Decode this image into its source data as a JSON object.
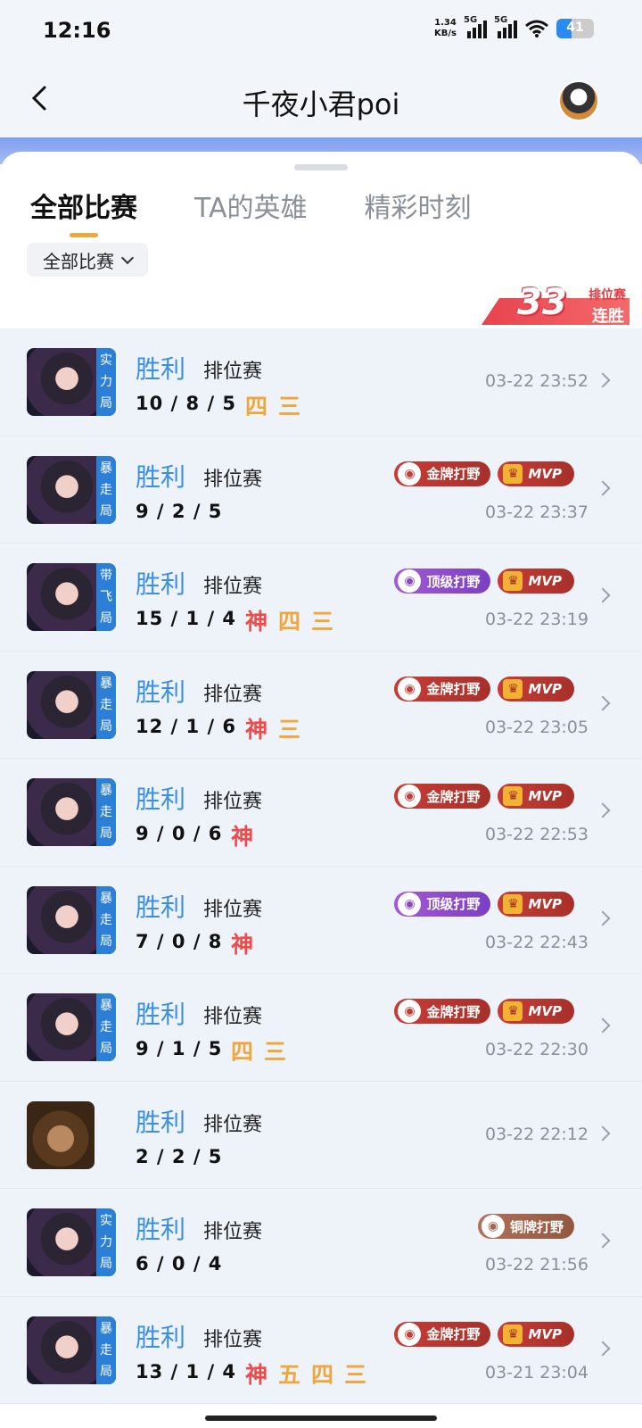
{
  "status": {
    "time": "12:16",
    "net_speed_value": "1.34",
    "net_speed_unit": "KB/s",
    "sig1": "5G",
    "sig2": "5G",
    "battery": "41"
  },
  "header": {
    "title": "千夜小君poi"
  },
  "tabs": [
    "全部比赛",
    "TA的英雄",
    "精彩时刻"
  ],
  "filter": {
    "label": "全部比赛"
  },
  "streak": {
    "count": "33",
    "top": "排位赛",
    "bottom": "连胜"
  },
  "matches": [
    {
      "tag": "实力局",
      "hero": "girl",
      "result": "胜利",
      "mode": "排位赛",
      "kda": "10 / 8 / 5",
      "marks": [
        "四",
        "三"
      ],
      "badges": [],
      "time": "03-22 23:52"
    },
    {
      "tag": "暴走局",
      "hero": "girl",
      "result": "胜利",
      "mode": "排位赛",
      "kda": "9 / 2 / 5",
      "marks": [],
      "badges": [
        "金牌打野",
        "MVP"
      ],
      "time": "03-22 23:37"
    },
    {
      "tag": "带飞局",
      "hero": "girl",
      "result": "胜利",
      "mode": "排位赛",
      "kda": "15 / 1 / 4",
      "marks": [
        "神",
        "四",
        "三"
      ],
      "badges": [
        "顶级打野",
        "MVP"
      ],
      "time": "03-22 23:19"
    },
    {
      "tag": "暴走局",
      "hero": "girl",
      "result": "胜利",
      "mode": "排位赛",
      "kda": "12 / 1 / 6",
      "marks": [
        "神",
        "三"
      ],
      "badges": [
        "金牌打野",
        "MVP"
      ],
      "time": "03-22 23:05"
    },
    {
      "tag": "暴走局",
      "hero": "girl",
      "result": "胜利",
      "mode": "排位赛",
      "kda": "9 / 0 / 6",
      "marks": [
        "神"
      ],
      "badges": [
        "金牌打野",
        "MVP"
      ],
      "time": "03-22 22:53"
    },
    {
      "tag": "暴走局",
      "hero": "girl",
      "result": "胜利",
      "mode": "排位赛",
      "kda": "7 / 0 / 8",
      "marks": [
        "神"
      ],
      "badges": [
        "顶级打野",
        "MVP"
      ],
      "time": "03-22 22:43"
    },
    {
      "tag": "暴走局",
      "hero": "girl",
      "result": "胜利",
      "mode": "排位赛",
      "kda": "9 / 1 / 5",
      "marks": [
        "四",
        "三"
      ],
      "badges": [
        "金牌打野",
        "MVP"
      ],
      "time": "03-22 22:30"
    },
    {
      "tag": "",
      "hero": "monk",
      "result": "胜利",
      "mode": "排位赛",
      "kda": "2 / 2 / 5",
      "marks": [],
      "badges": [],
      "time": "03-22 22:12"
    },
    {
      "tag": "实力局",
      "hero": "girl",
      "result": "胜利",
      "mode": "排位赛",
      "kda": "6 / 0 / 4",
      "marks": [],
      "badges": [
        "铜牌打野"
      ],
      "time": "03-22 21:56"
    },
    {
      "tag": "暴走局",
      "hero": "girl",
      "result": "胜利",
      "mode": "排位赛",
      "kda": "13 / 1 / 4",
      "marks": [
        "神",
        "五",
        "四",
        "三"
      ],
      "badges": [
        "金牌打野",
        "MVP"
      ],
      "time": "03-21 23:04"
    }
  ]
}
